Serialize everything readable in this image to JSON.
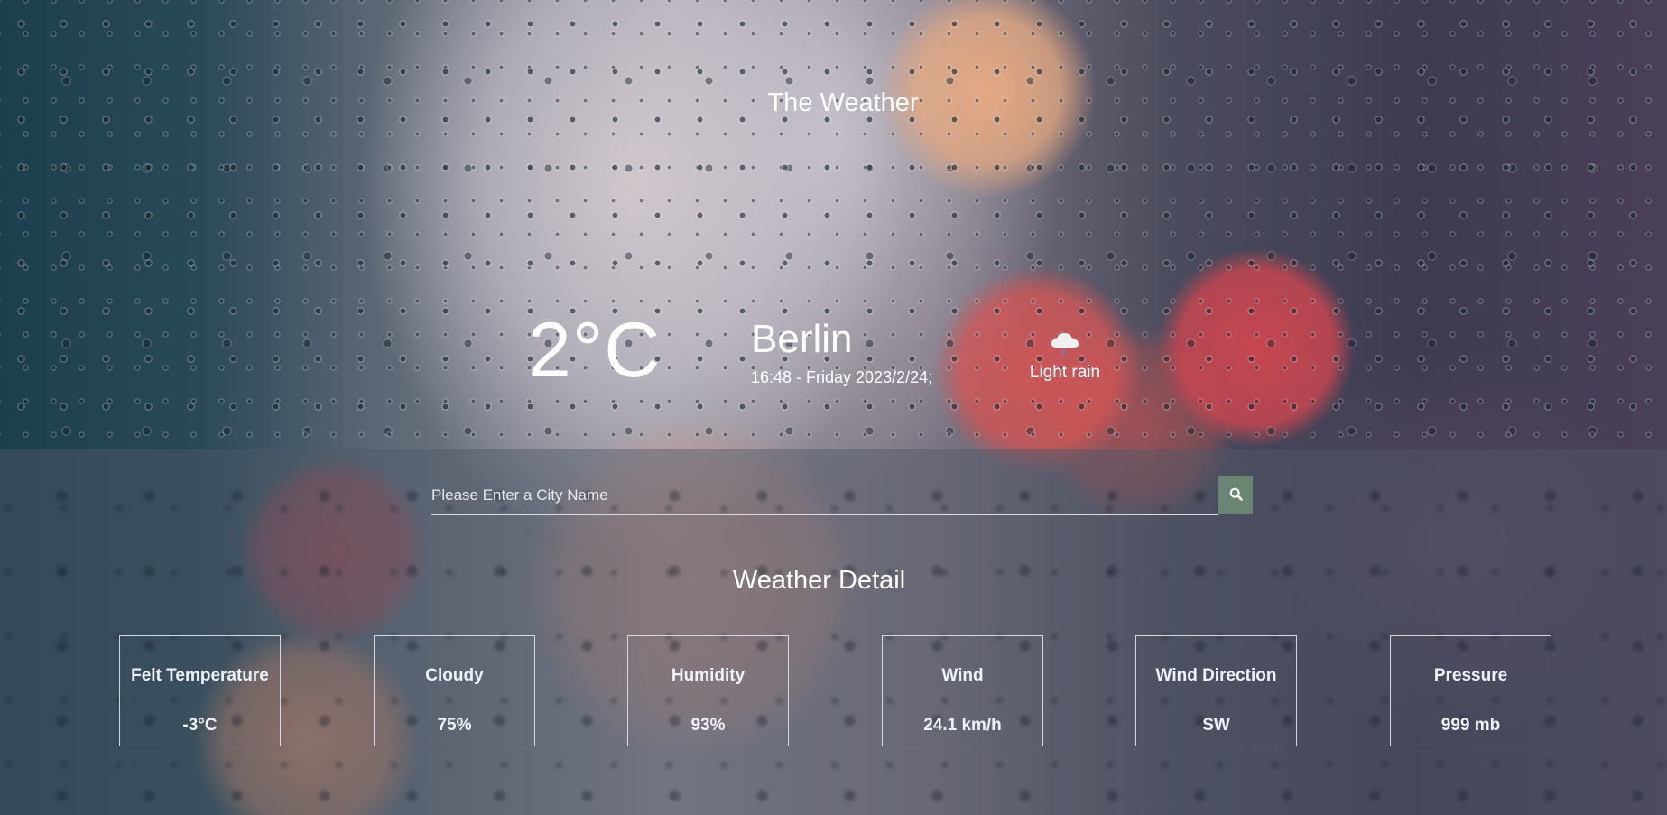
{
  "app": {
    "title": "The Weather"
  },
  "current": {
    "temperature": "2°C",
    "city": "Berlin",
    "datetime": "16:48 - Friday 2023/2/24;",
    "condition_icon": "cloud-rain-icon",
    "condition": "Light rain"
  },
  "search": {
    "placeholder": "Please Enter a City Name",
    "value": "",
    "button_icon": "search-icon"
  },
  "detail": {
    "title": "Weather Detail",
    "cards": [
      {
        "label": "Felt Temperature",
        "value": "-3°C"
      },
      {
        "label": "Cloudy",
        "value": "75%"
      },
      {
        "label": "Humidity",
        "value": "93%"
      },
      {
        "label": "Wind",
        "value": "24.1 km/h"
      },
      {
        "label": "Wind Direction",
        "value": "SW"
      },
      {
        "label": "Pressure",
        "value": "999 mb"
      }
    ]
  },
  "colors": {
    "search_button": "#6b8574",
    "text": "#ffffff"
  }
}
